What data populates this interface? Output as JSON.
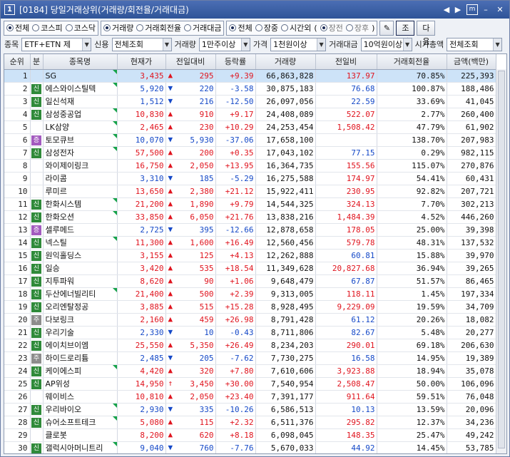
{
  "window": {
    "screen_num": "1",
    "title": "[0184] 당일거래상위(거래량/회전율/거래대금)"
  },
  "titlebar": {
    "prev": "◀",
    "next": "▶",
    "m": "m",
    "min": "–",
    "close": "✕"
  },
  "filters": {
    "market": {
      "options": [
        "전체",
        "코스피",
        "코스닥"
      ],
      "selected": 0
    },
    "sort": {
      "options": [
        "거래량",
        "거래회전율",
        "거래대금"
      ],
      "selected": 0
    },
    "session": {
      "options": [
        "전체",
        "장중",
        "시간외"
      ],
      "selected": 0
    },
    "subsession": {
      "options": [
        "장전",
        "장후"
      ],
      "selected": 0
    },
    "lookup_label": "조회",
    "next_label": "다음"
  },
  "filter2": {
    "item_label": "종목",
    "item_value": "ETF+ETN 제",
    "credit_label": "신용",
    "credit_value": "전체조회",
    "volume_label": "거래량",
    "volume_value": "1만주이상",
    "price_label": "가격",
    "price_value": "1천원이상",
    "amount_label": "거래대금",
    "amount_value": "10억원이상",
    "mcap_label": "시가총액",
    "mcap_value": "전체조회"
  },
  "table": {
    "headers": [
      "순위",
      "분",
      "종목명",
      "현재가",
      "전일대비",
      "등락률",
      "거래량",
      "전일비",
      "거래회전율",
      "금액(백만)"
    ],
    "rows": [
      {
        "rank": "1",
        "badge": "",
        "name": "SG",
        "price": "3,435",
        "dir": "up",
        "chg": "295",
        "rate": "+9.39",
        "vol": "66,863,828",
        "prev": "137.97",
        "turn": "70.85%",
        "amt": "225,393",
        "flag": true
      },
      {
        "rank": "2",
        "badge": "신",
        "name": "에스와이스틸텍",
        "price": "5,920",
        "dir": "down",
        "chg": "220",
        "rate": "-3.58",
        "vol": "30,875,183",
        "prev": "76.68",
        "turn": "100.87%",
        "amt": "188,486",
        "flag": true
      },
      {
        "rank": "3",
        "badge": "신",
        "name": "일신석재",
        "price": "1,512",
        "dir": "down",
        "chg": "216",
        "rate": "-12.50",
        "vol": "26,097,056",
        "prev": "22.59",
        "turn": "33.69%",
        "amt": "41,045",
        "flag": false
      },
      {
        "rank": "4",
        "badge": "신",
        "name": "삼성중공업",
        "price": "10,830",
        "dir": "up",
        "chg": "910",
        "rate": "+9.17",
        "vol": "24,408,089",
        "prev": "522.07",
        "turn": "2.77%",
        "amt": "260,400",
        "flag": true
      },
      {
        "rank": "5",
        "badge": "",
        "name": "LK삼양",
        "price": "2,465",
        "dir": "up",
        "chg": "230",
        "rate": "+10.29",
        "vol": "24,253,454",
        "prev": "1,508.42",
        "turn": "47.79%",
        "amt": "61,902",
        "flag": true
      },
      {
        "rank": "6",
        "badge": "증",
        "name": "토모큐브",
        "price": "10,070",
        "dir": "down",
        "chg": "5,930",
        "rate": "-37.06",
        "vol": "17,658,100",
        "prev": "",
        "turn": "138.70%",
        "amt": "207,983",
        "flag": true
      },
      {
        "rank": "7",
        "badge": "신",
        "name": "삼성전자",
        "price": "57,500",
        "dir": "up",
        "chg": "200",
        "rate": "+0.35",
        "vol": "17,043,102",
        "prev": "77.15",
        "turn": "0.29%",
        "amt": "982,115",
        "flag": true
      },
      {
        "rank": "8",
        "badge": "",
        "name": "와이제이링크",
        "price": "16,750",
        "dir": "up",
        "chg": "2,050",
        "rate": "+13.95",
        "vol": "16,364,735",
        "prev": "155.56",
        "turn": "115.07%",
        "amt": "270,876",
        "flag": false
      },
      {
        "rank": "9",
        "badge": "",
        "name": "라이콤",
        "price": "3,310",
        "dir": "down",
        "chg": "185",
        "rate": "-5.29",
        "vol": "16,275,588",
        "prev": "174.97",
        "turn": "54.41%",
        "amt": "60,431",
        "flag": false
      },
      {
        "rank": "10",
        "badge": "",
        "name": "루미르",
        "price": "13,650",
        "dir": "up",
        "chg": "2,380",
        "rate": "+21.12",
        "vol": "15,922,411",
        "prev": "230.95",
        "turn": "92.82%",
        "amt": "207,721",
        "flag": false
      },
      {
        "rank": "11",
        "badge": "신",
        "name": "한화시스템",
        "price": "21,200",
        "dir": "up",
        "chg": "1,890",
        "rate": "+9.79",
        "vol": "14,544,325",
        "prev": "324.13",
        "turn": "7.70%",
        "amt": "302,213",
        "flag": true
      },
      {
        "rank": "12",
        "badge": "신",
        "name": "한화오션",
        "price": "33,850",
        "dir": "up",
        "chg": "6,050",
        "rate": "+21.76",
        "vol": "13,838,216",
        "prev": "1,484.39",
        "turn": "4.52%",
        "amt": "446,260",
        "flag": true
      },
      {
        "rank": "13",
        "badge": "증",
        "name": "셀루메드",
        "price": "2,725",
        "dir": "down",
        "chg": "395",
        "rate": "-12.66",
        "vol": "12,878,658",
        "prev": "178.05",
        "turn": "25.00%",
        "amt": "39,398",
        "flag": false
      },
      {
        "rank": "14",
        "badge": "신",
        "name": "넥스틸",
        "price": "11,300",
        "dir": "up",
        "chg": "1,600",
        "rate": "+16.49",
        "vol": "12,560,456",
        "prev": "579.78",
        "turn": "48.31%",
        "amt": "137,532",
        "flag": true
      },
      {
        "rank": "15",
        "badge": "신",
        "name": "원익홀딩스",
        "price": "3,155",
        "dir": "up",
        "chg": "125",
        "rate": "+4.13",
        "vol": "12,262,888",
        "prev": "60.81",
        "turn": "15.88%",
        "amt": "39,970",
        "flag": false
      },
      {
        "rank": "16",
        "badge": "신",
        "name": "일승",
        "price": "3,420",
        "dir": "up",
        "chg": "535",
        "rate": "+18.54",
        "vol": "11,349,628",
        "prev": "20,827.68",
        "turn": "36.94%",
        "amt": "39,265",
        "flag": false
      },
      {
        "rank": "17",
        "badge": "신",
        "name": "지투파워",
        "price": "8,620",
        "dir": "up",
        "chg": "90",
        "rate": "+1.06",
        "vol": "9,648,479",
        "prev": "67.87",
        "turn": "51.57%",
        "amt": "86,465",
        "flag": false
      },
      {
        "rank": "18",
        "badge": "신",
        "name": "두산에너빌리티",
        "price": "21,400",
        "dir": "up",
        "chg": "500",
        "rate": "+2.39",
        "vol": "9,313,005",
        "prev": "118.11",
        "turn": "1.45%",
        "amt": "197,334",
        "flag": true
      },
      {
        "rank": "19",
        "badge": "신",
        "name": "오리엔탈정공",
        "price": "3,885",
        "dir": "up",
        "chg": "515",
        "rate": "+15.28",
        "vol": "8,928,495",
        "prev": "9,229.09",
        "turn": "19.59%",
        "amt": "34,709",
        "flag": false
      },
      {
        "rank": "20",
        "badge": "주",
        "name": "다보링크",
        "price": "2,160",
        "dir": "up",
        "chg": "459",
        "rate": "+26.98",
        "vol": "8,791,428",
        "prev": "61.12",
        "turn": "20.26%",
        "amt": "18,082",
        "flag": false
      },
      {
        "rank": "21",
        "badge": "신",
        "name": "우리기술",
        "price": "2,330",
        "dir": "down",
        "chg": "10",
        "rate": "-0.43",
        "vol": "8,711,806",
        "prev": "82.67",
        "turn": "5.48%",
        "amt": "20,277",
        "flag": false
      },
      {
        "rank": "22",
        "badge": "신",
        "name": "에이치브이엠",
        "price": "25,550",
        "dir": "up",
        "chg": "5,350",
        "rate": "+26.49",
        "vol": "8,234,203",
        "prev": "290.01",
        "turn": "69.18%",
        "amt": "206,630",
        "flag": false
      },
      {
        "rank": "23",
        "badge": "주",
        "name": "하이드로리튬",
        "price": "2,485",
        "dir": "down",
        "chg": "205",
        "rate": "-7.62",
        "vol": "7,730,275",
        "prev": "16.58",
        "turn": "14.95%",
        "amt": "19,389",
        "flag": false
      },
      {
        "rank": "24",
        "badge": "신",
        "name": "케이에스피",
        "price": "4,420",
        "dir": "up",
        "chg": "320",
        "rate": "+7.80",
        "vol": "7,610,606",
        "prev": "3,923.88",
        "turn": "18.94%",
        "amt": "35,078",
        "flag": true
      },
      {
        "rank": "25",
        "badge": "신",
        "name": "AP위성",
        "price": "14,950",
        "dir": "upper",
        "chg": "3,450",
        "rate": "+30.00",
        "vol": "7,540,954",
        "prev": "2,508.47",
        "turn": "50.00%",
        "amt": "106,096",
        "flag": false
      },
      {
        "rank": "26",
        "badge": "",
        "name": "웨이비스",
        "price": "10,810",
        "dir": "up",
        "chg": "2,050",
        "rate": "+23.40",
        "vol": "7,391,177",
        "prev": "911.64",
        "turn": "59.51%",
        "amt": "76,048",
        "flag": false
      },
      {
        "rank": "27",
        "badge": "신",
        "name": "우리바이오",
        "price": "2,930",
        "dir": "down",
        "chg": "335",
        "rate": "-10.26",
        "vol": "6,586,513",
        "prev": "10.13",
        "turn": "13.59%",
        "amt": "20,096",
        "flag": true
      },
      {
        "rank": "28",
        "badge": "신",
        "name": "슈어소프트테크",
        "price": "5,080",
        "dir": "up",
        "chg": "115",
        "rate": "+2.32",
        "vol": "6,511,376",
        "prev": "295.82",
        "turn": "12.37%",
        "amt": "34,236",
        "flag": true
      },
      {
        "rank": "29",
        "badge": "",
        "name": "클로봇",
        "price": "8,200",
        "dir": "up",
        "chg": "620",
        "rate": "+8.18",
        "vol": "6,098,045",
        "prev": "148.35",
        "turn": "25.47%",
        "amt": "49,242",
        "flag": false
      },
      {
        "rank": "30",
        "badge": "신",
        "name": "갤럭시아머니트리",
        "price": "9,040",
        "dir": "down",
        "chg": "760",
        "rate": "-7.76",
        "vol": "5,670,033",
        "prev": "44.92",
        "turn": "14.45%",
        "amt": "53,785",
        "flag": true
      }
    ]
  },
  "colors": {
    "up": "#e0141e",
    "down": "#1549c8",
    "badge_new": "#2f8a3a",
    "badge_inc": "#a35bbf",
    "badge_gray": "#8c8c8c"
  }
}
